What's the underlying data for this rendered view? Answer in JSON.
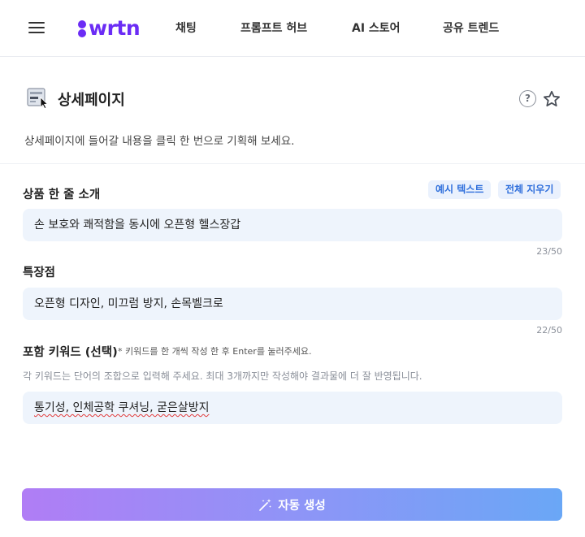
{
  "brand": {
    "logo_text": "wrtn",
    "accent_color": "#6b2cf5"
  },
  "nav": {
    "items": [
      {
        "label": "채팅"
      },
      {
        "label": "프롬프트 허브"
      },
      {
        "label": "AI 스토어"
      },
      {
        "label": "공유 트렌드"
      }
    ]
  },
  "header": {
    "title": "상세페이지",
    "subtitle": "상세페이지에 들어갈 내용을 클릭 한 번으로 기획해 보세요.",
    "help_label": "?"
  },
  "form": {
    "intro": {
      "label": "상품 한 줄 소개",
      "example_button": "예시 텍스트",
      "clear_button": "전체 지우기",
      "value": "손 보호와 쾌적함을 동시에 오픈형 헬스장갑",
      "counter": "23/50"
    },
    "features": {
      "label": "특장점",
      "value": "오픈형 디자인, 미끄럼 방지, 손목벨크로",
      "counter": "22/50"
    },
    "keywords": {
      "label": "포함 키워드 (선택)",
      "note": "* 키워드를 한 개씩 작성 한 후 Enter를 눌러주세요.",
      "hint": "각 키워드는 단어의 조합으로 입력해 주세요. 최대 3개까지만 작성해야 결과물에 더 잘 반영됩니다.",
      "value": "통기성, 인체공학 쿠셔닝, 굳은살방지"
    }
  },
  "generate_button": {
    "label": "자동 생성"
  },
  "icons": [
    "menu-icon",
    "document-cursor-icon",
    "help-icon",
    "star-icon",
    "magic-wand-icon"
  ]
}
